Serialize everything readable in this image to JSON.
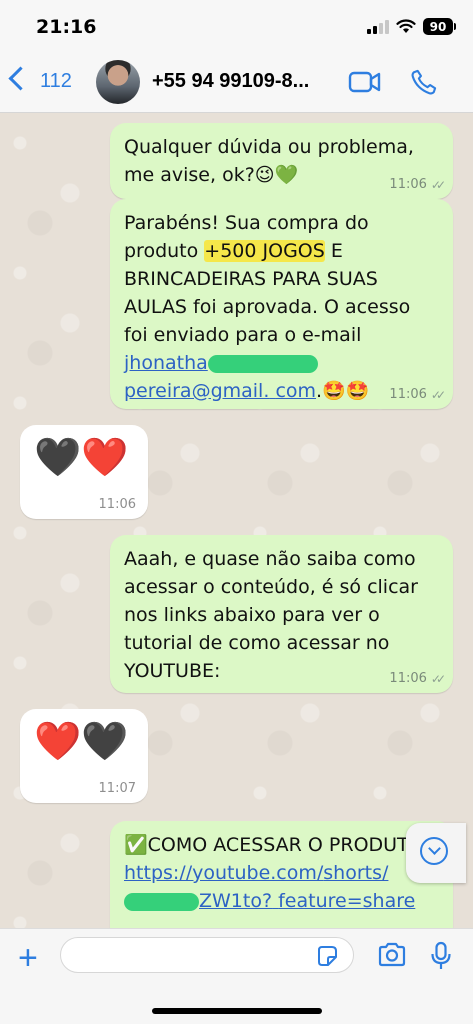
{
  "status_bar": {
    "time": "21:16",
    "battery": "90"
  },
  "header": {
    "back_count": "112",
    "contact_name": "+55 94 99109-8..."
  },
  "messages": [
    {
      "id": "m1",
      "direction": "out",
      "text": "Qualquer dúvida ou problema, me avise, ok?😉💚",
      "time": "11:06"
    },
    {
      "id": "m2",
      "direction": "out",
      "text_before": "Parabéns! Sua compra do produto ",
      "highlight": "+500 JOGOS",
      "text_after": " E BRINCADEIRAS PARA SUAS AULAS foi aprovada. O acesso foi enviado para o e-mail ",
      "email_start": "jhonatha",
      "email_end": "pereira@gmail.",
      "email_tail": "com",
      "emoji": ".🤩🤩",
      "time": "11:06"
    },
    {
      "id": "m3",
      "direction": "in",
      "text": "🖤❤️",
      "time": "11:06"
    },
    {
      "id": "m4",
      "direction": "out",
      "text": "Aaah, e quase não saiba como acessar o conteúdo, é só clicar nos links abaixo para ver o tutorial de como acessar no YOUTUBE:",
      "time": "11:06"
    },
    {
      "id": "m5",
      "direction": "in",
      "text": "❤️🖤",
      "time": "11:07"
    },
    {
      "id": "m6",
      "direction": "out",
      "text_before": "✅COMO ACESSAR O PRODUTO: ",
      "link_start": "https://youtube.com/",
      "link_mid": "shorts/",
      "link_end": "ZW1to?",
      "link_tail": "feature=share"
    }
  ],
  "colors": {
    "accent": "#2e7ee0",
    "outgoing_bubble": "#dcf8c6",
    "incoming_bubble": "#ffffff",
    "highlight": "#f5e74a",
    "link": "#2d62c4"
  },
  "icons": [
    "back-chevron-icon",
    "video-call-icon",
    "phone-icon",
    "chevron-down-icon",
    "plus-icon",
    "sticker-icon",
    "camera-icon",
    "microphone-icon",
    "signal-icon",
    "wifi-icon",
    "battery-icon"
  ]
}
